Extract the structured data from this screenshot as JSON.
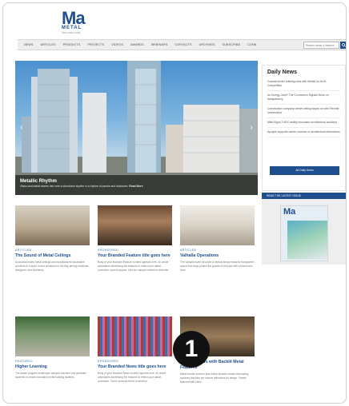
{
  "brand": {
    "logo_mark": "Ma",
    "logo_word": "METAL",
    "logo_tagline": "ARCHITECTURE"
  },
  "nav": {
    "items": [
      "NEWS",
      "ARTICLES",
      "PRODUCTS",
      "PROJECTS",
      "VIDEOS",
      "AWARDS",
      "WEBINARS",
      "CONTACTS",
      "ARCHIVES",
      "SUBSCRIBE",
      "CONN"
    ],
    "search_placeholder": "Search news & feature"
  },
  "hero": {
    "title": "Metallic Rhythm",
    "description": "Glass-and-metal towers rise over a downtown skyline in a rhythm of panels and balconies.",
    "read_more": "Read More"
  },
  "daily": {
    "title": "Daily News",
    "items": [
      "Coastal center building wins with Metals for",
      "ACM Competition",
      "An Energy Joint? The Connection Signals Move on",
      "transparency",
      "Construction company center ceiling forges on",
      "with Flexible connections",
      "MBA Signs 2 ARC facility innovated architectural",
      "solutions",
      "Apogee supports career success of",
      "architectural dimensions"
    ],
    "button": "All Daily News"
  },
  "issue": {
    "label": "READ THE LATEST ISSUE",
    "cover_logo": "Ma"
  },
  "cards": [
    {
      "category": "ARTICLES",
      "title": "The Sound of Metal Ceilings",
      "body": "Acoustical tested metal ceilings and manufactured accessible solutions to a quiet, sound solutions for the Bay among residents, designers, and architects."
    },
    {
      "category": "SPONSORED",
      "title": "Your Branded Feature title goes here",
      "body": "Body of your Branded Feature content appears here. All online advertisers advertising the features to reflect your native promotion content appear. Like our sample content to describe."
    },
    {
      "category": "ARTICLES",
      "title": "Valhalla Operations",
      "body": "The Valhalla tower structure a vertical library featured transparent space that helps protect the growth of the past with a brand new level."
    },
    {
      "category": "FEATURED",
      "title": "Higher Learning",
      "body": "The award program challenges campus teachers and graduate students to create innovative metal building facilities."
    },
    {
      "category": "SPONSORED",
      "title": "Your Branded News title goes here",
      "body": "Body of your Branded News content appears here. All online advertisers advertising the features to reflect your native promotion. Call to promote items to develop."
    },
    {
      "category": "",
      "title": "Mosaic Glows with Backlit Metal Features",
      "body": "Metal mosaic screens and visible facades create illuminating surfaces that tiles are natural reflections for design. Panels featured with shine."
    }
  ],
  "marker": "1",
  "colors": {
    "brand_blue": "#1f4f8f",
    "link_blue": "#2d6fa8"
  }
}
